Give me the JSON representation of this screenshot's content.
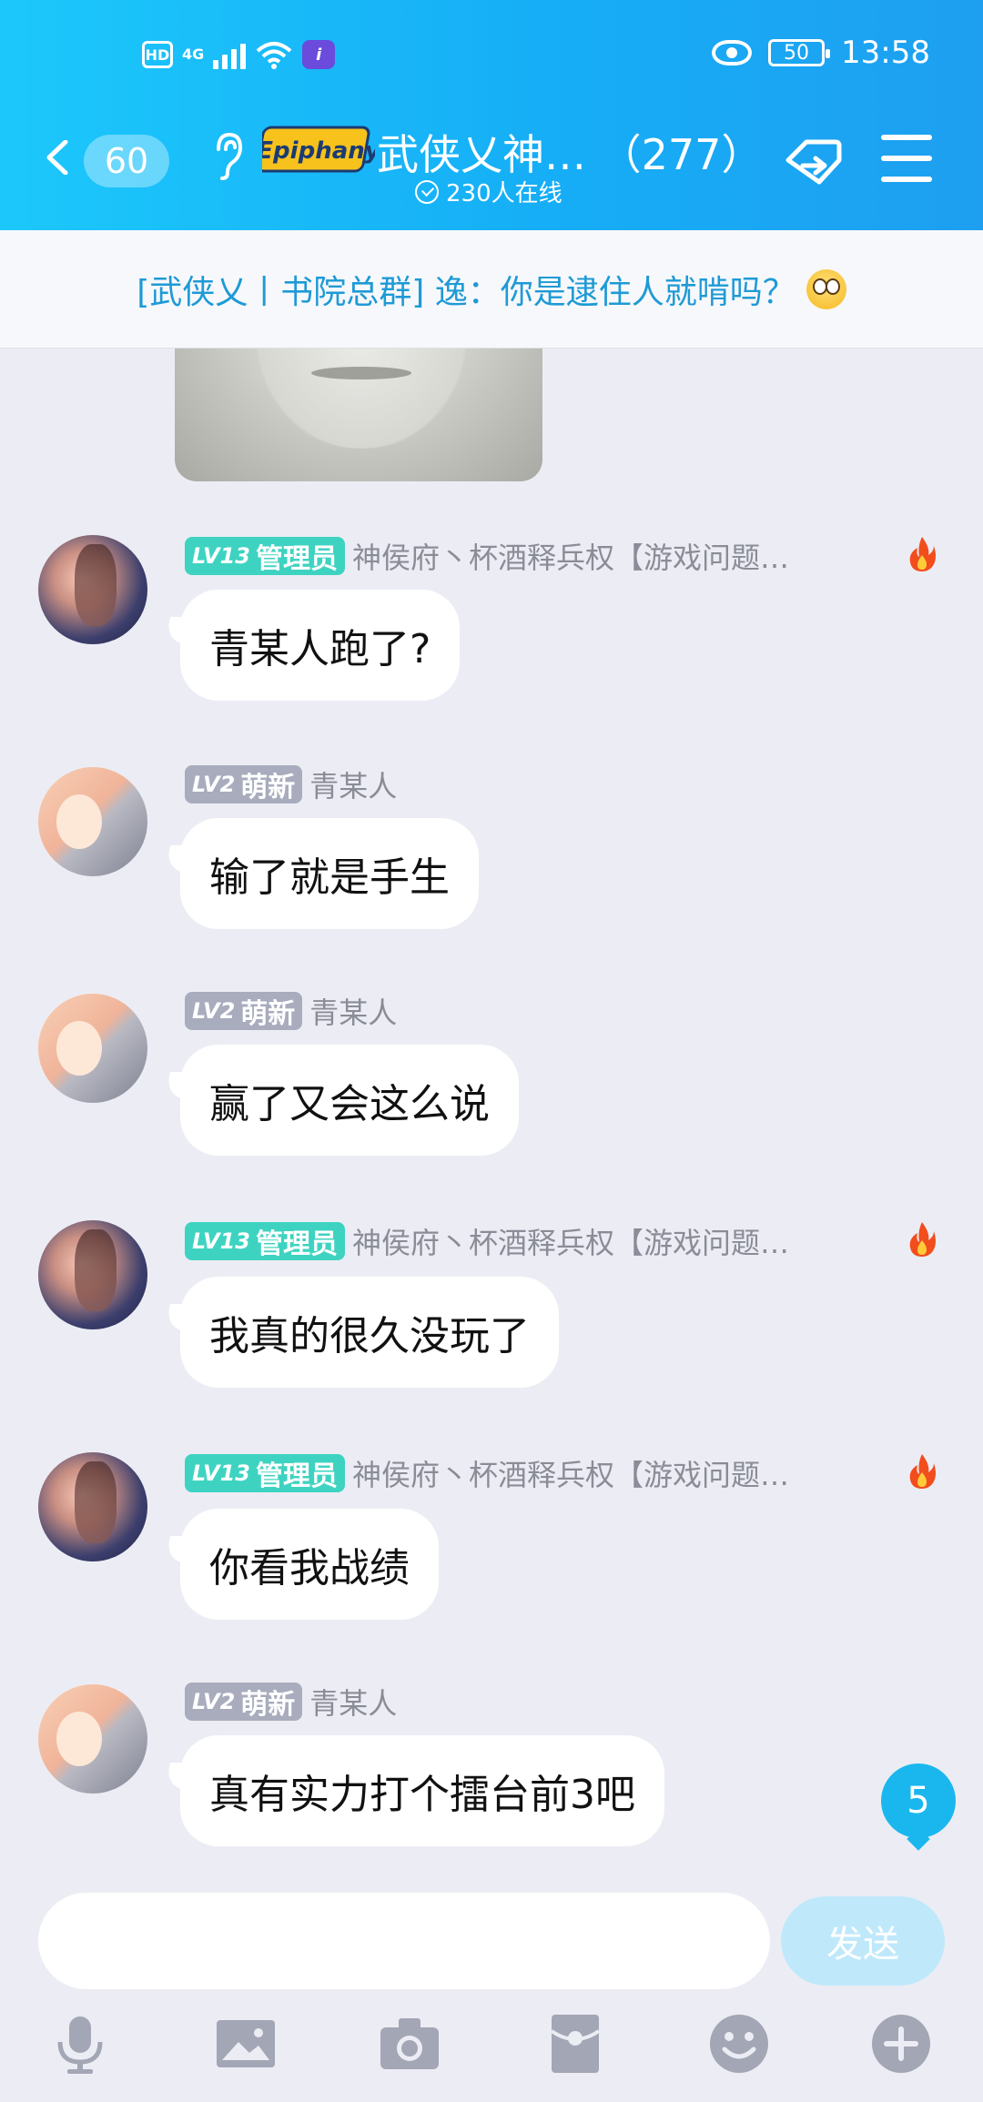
{
  "status_bar": {
    "hd": "HD",
    "network": "4G",
    "battery": "50",
    "time": "13:58"
  },
  "nav": {
    "back_count": "60",
    "logo_text": "Epiphany",
    "title": "武侠乂神…",
    "member_count": "（277）",
    "online": "230人在线"
  },
  "notice": {
    "text": "[武侠乂丨书院总群] 逸：你是逮住人就啃吗？"
  },
  "messages": [
    {
      "level": "LV13",
      "role": "管理员",
      "sender": "神侯府丶杯酒释兵权【游戏问题…",
      "text": "青某人跑了?"
    },
    {
      "level": "LV2",
      "role": "萌新",
      "sender": "青某人",
      "text": "输了就是手生"
    },
    {
      "level": "LV2",
      "role": "萌新",
      "sender": "青某人",
      "text": "赢了又会这么说"
    },
    {
      "level": "LV13",
      "role": "管理员",
      "sender": "神侯府丶杯酒释兵权【游戏问题…",
      "text": "我真的很久没玩了"
    },
    {
      "level": "LV13",
      "role": "管理员",
      "sender": "神侯府丶杯酒释兵权【游戏问题…",
      "text": "你看我战绩"
    },
    {
      "level": "LV2",
      "role": "萌新",
      "sender": "青某人",
      "text": "真有实力打个擂台前3吧"
    }
  ],
  "unread_count": "5",
  "input": {
    "value": "",
    "send_label": "发送"
  },
  "toolbar": [
    "microphone-icon",
    "image-icon",
    "camera-icon",
    "red-packet-icon",
    "emoji-icon",
    "plus-icon"
  ],
  "colors": {
    "header": "#16aef6",
    "admin_badge": "#3ed3c1",
    "newbie_badge": "#a8acbd",
    "notice_text": "#1e9ad6",
    "send_button": "#bfe9fb"
  }
}
